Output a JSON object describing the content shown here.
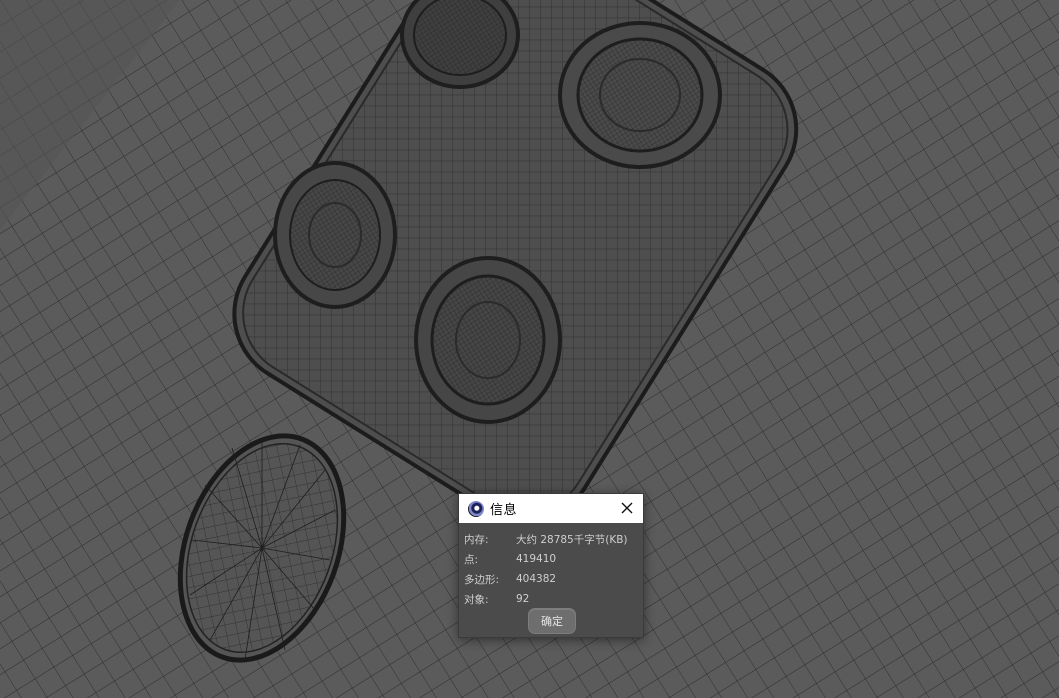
{
  "dialog": {
    "title": "信息",
    "app_icon": "cinema4d-logo-icon",
    "close_icon": "close-icon",
    "rows": [
      {
        "label": "内存:",
        "value": "大约 28785千字节(KB)"
      },
      {
        "label": "点:",
        "value": "419410"
      },
      {
        "label": "多边形:",
        "value": "404382"
      },
      {
        "label": "对象:",
        "value": "92"
      }
    ],
    "ok_label": "确定"
  },
  "viewport": {
    "background_color": "#5a5a5a",
    "wire_color": "#222222",
    "view": "wireframe-mesh"
  }
}
